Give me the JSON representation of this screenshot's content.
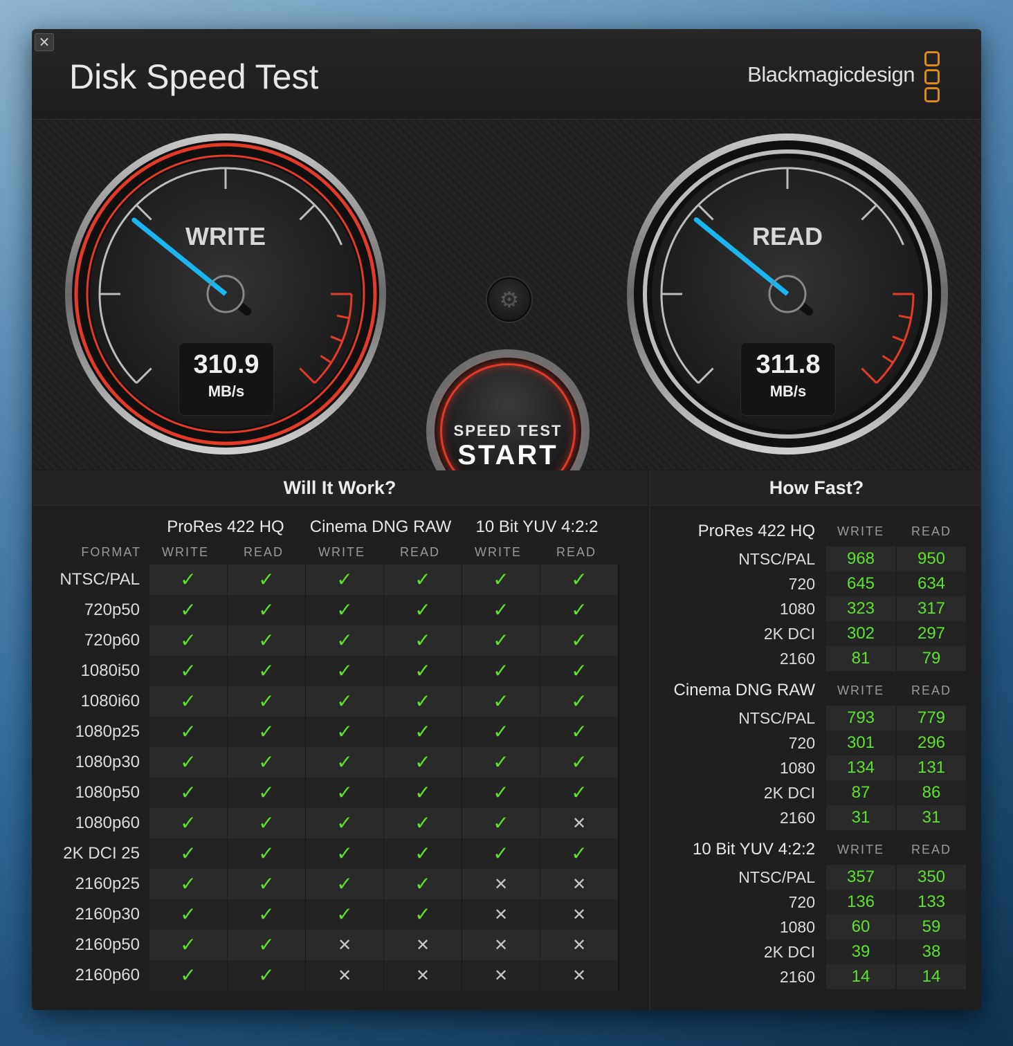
{
  "window": {
    "title": "Disk Speed Test",
    "brand": "Blackmagicdesign",
    "close_icon": "×"
  },
  "colors": {
    "accent_green": "#5fe22e",
    "needle_blue": "#19b6f0",
    "gauge_red": "#e33a2a",
    "logo_orange": "#e08a18"
  },
  "gauges": {
    "write": {
      "label": "WRITE",
      "value": "310.9",
      "unit": "MB/s",
      "value_num": 310.9
    },
    "read": {
      "label": "READ",
      "value": "311.8",
      "unit": "MB/s",
      "value_num": 311.8
    }
  },
  "controls": {
    "settings_icon": "⚙",
    "start_small": "SPEED TEST",
    "start_big": "START"
  },
  "will_it_work": {
    "title": "Will It Work?",
    "format_label": "FORMAT",
    "codecs": [
      "ProRes 422 HQ",
      "Cinema DNG RAW",
      "10 Bit YUV 4:2:2"
    ],
    "columns": [
      "WRITE",
      "READ",
      "WRITE",
      "READ",
      "WRITE",
      "READ"
    ],
    "ok_icon": "✓",
    "no_icon": "✕",
    "rows": [
      {
        "format": "NTSC/PAL",
        "cells": [
          1,
          1,
          1,
          1,
          1,
          1
        ]
      },
      {
        "format": "720p50",
        "cells": [
          1,
          1,
          1,
          1,
          1,
          1
        ]
      },
      {
        "format": "720p60",
        "cells": [
          1,
          1,
          1,
          1,
          1,
          1
        ]
      },
      {
        "format": "1080i50",
        "cells": [
          1,
          1,
          1,
          1,
          1,
          1
        ]
      },
      {
        "format": "1080i60",
        "cells": [
          1,
          1,
          1,
          1,
          1,
          1
        ]
      },
      {
        "format": "1080p25",
        "cells": [
          1,
          1,
          1,
          1,
          1,
          1
        ]
      },
      {
        "format": "1080p30",
        "cells": [
          1,
          1,
          1,
          1,
          1,
          1
        ]
      },
      {
        "format": "1080p50",
        "cells": [
          1,
          1,
          1,
          1,
          1,
          1
        ]
      },
      {
        "format": "1080p60",
        "cells": [
          1,
          1,
          1,
          1,
          1,
          0
        ]
      },
      {
        "format": "2K DCI 25",
        "cells": [
          1,
          1,
          1,
          1,
          1,
          1
        ]
      },
      {
        "format": "2160p25",
        "cells": [
          1,
          1,
          1,
          1,
          0,
          0
        ]
      },
      {
        "format": "2160p30",
        "cells": [
          1,
          1,
          1,
          1,
          0,
          0
        ]
      },
      {
        "format": "2160p50",
        "cells": [
          1,
          1,
          0,
          0,
          0,
          0
        ]
      },
      {
        "format": "2160p60",
        "cells": [
          1,
          1,
          0,
          0,
          0,
          0
        ]
      }
    ]
  },
  "how_fast": {
    "title": "How Fast?",
    "sections": [
      {
        "codec": "ProRes 422 HQ",
        "write_label": "WRITE",
        "read_label": "READ",
        "rows": [
          {
            "format": "NTSC/PAL",
            "write": "968",
            "read": "950"
          },
          {
            "format": "720",
            "write": "645",
            "read": "634"
          },
          {
            "format": "1080",
            "write": "323",
            "read": "317"
          },
          {
            "format": "2K DCI",
            "write": "302",
            "read": "297"
          },
          {
            "format": "2160",
            "write": "81",
            "read": "79"
          }
        ]
      },
      {
        "codec": "Cinema DNG RAW",
        "write_label": "WRITE",
        "read_label": "READ",
        "rows": [
          {
            "format": "NTSC/PAL",
            "write": "793",
            "read": "779"
          },
          {
            "format": "720",
            "write": "301",
            "read": "296"
          },
          {
            "format": "1080",
            "write": "134",
            "read": "131"
          },
          {
            "format": "2K DCI",
            "write": "87",
            "read": "86"
          },
          {
            "format": "2160",
            "write": "31",
            "read": "31"
          }
        ]
      },
      {
        "codec": "10 Bit YUV 4:2:2",
        "write_label": "WRITE",
        "read_label": "READ",
        "rows": [
          {
            "format": "NTSC/PAL",
            "write": "357",
            "read": "350"
          },
          {
            "format": "720",
            "write": "136",
            "read": "133"
          },
          {
            "format": "1080",
            "write": "60",
            "read": "59"
          },
          {
            "format": "2K DCI",
            "write": "39",
            "read": "38"
          },
          {
            "format": "2160",
            "write": "14",
            "read": "14"
          }
        ]
      }
    ]
  }
}
